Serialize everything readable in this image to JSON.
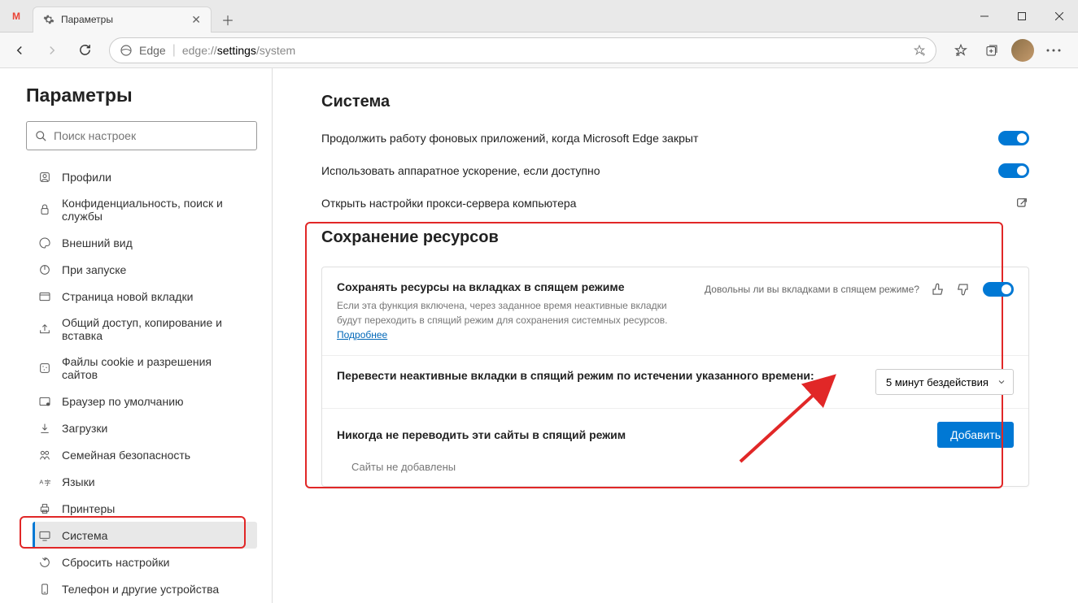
{
  "window": {
    "tab_title": "Параметры"
  },
  "toolbar": {
    "edge_label": "Edge",
    "url_prefix": "edge://",
    "url_main": "settings",
    "url_suffix": "/system"
  },
  "sidebar": {
    "title": "Параметры",
    "search_placeholder": "Поиск настроек",
    "items": [
      {
        "label": "Профили"
      },
      {
        "label": "Конфиденциальность, поиск и службы"
      },
      {
        "label": "Внешний вид"
      },
      {
        "label": "При запуске"
      },
      {
        "label": "Страница новой вкладки"
      },
      {
        "label": "Общий доступ, копирование и вставка"
      },
      {
        "label": "Файлы cookie и разрешения сайтов"
      },
      {
        "label": "Браузер по умолчанию"
      },
      {
        "label": "Загрузки"
      },
      {
        "label": "Семейная безопасность"
      },
      {
        "label": "Языки"
      },
      {
        "label": "Принтеры"
      },
      {
        "label": "Система"
      },
      {
        "label": "Сбросить настройки"
      },
      {
        "label": "Телефон и другие устройства"
      }
    ]
  },
  "main": {
    "section1_title": "Система",
    "row1": "Продолжить работу фоновых приложений, когда Microsoft Edge закрыт",
    "row2": "Использовать аппаратное ускорение, если доступно",
    "row3": "Открыть настройки прокси-сервера компьютера",
    "section2_title": "Сохранение ресурсов",
    "sleep": {
      "title": "Сохранять ресурсы на вкладках в спящем режиме",
      "desc": "Если эта функция включена, через заданное время неактивные вкладки будут переходить в спящий режим для сохранения системных ресурсов.",
      "more": "Подробнее",
      "feedback_q": "Довольны ли вы вкладками в спящем режиме?"
    },
    "timeout_label": "Перевести неактивные вкладки в спящий режим по истечении указанного времени:",
    "timeout_value": "5 минут бездействия",
    "never_label": "Никогда не переводить эти сайты в спящий режим",
    "add_btn": "Добавить",
    "empty": "Сайты не добавлены"
  }
}
